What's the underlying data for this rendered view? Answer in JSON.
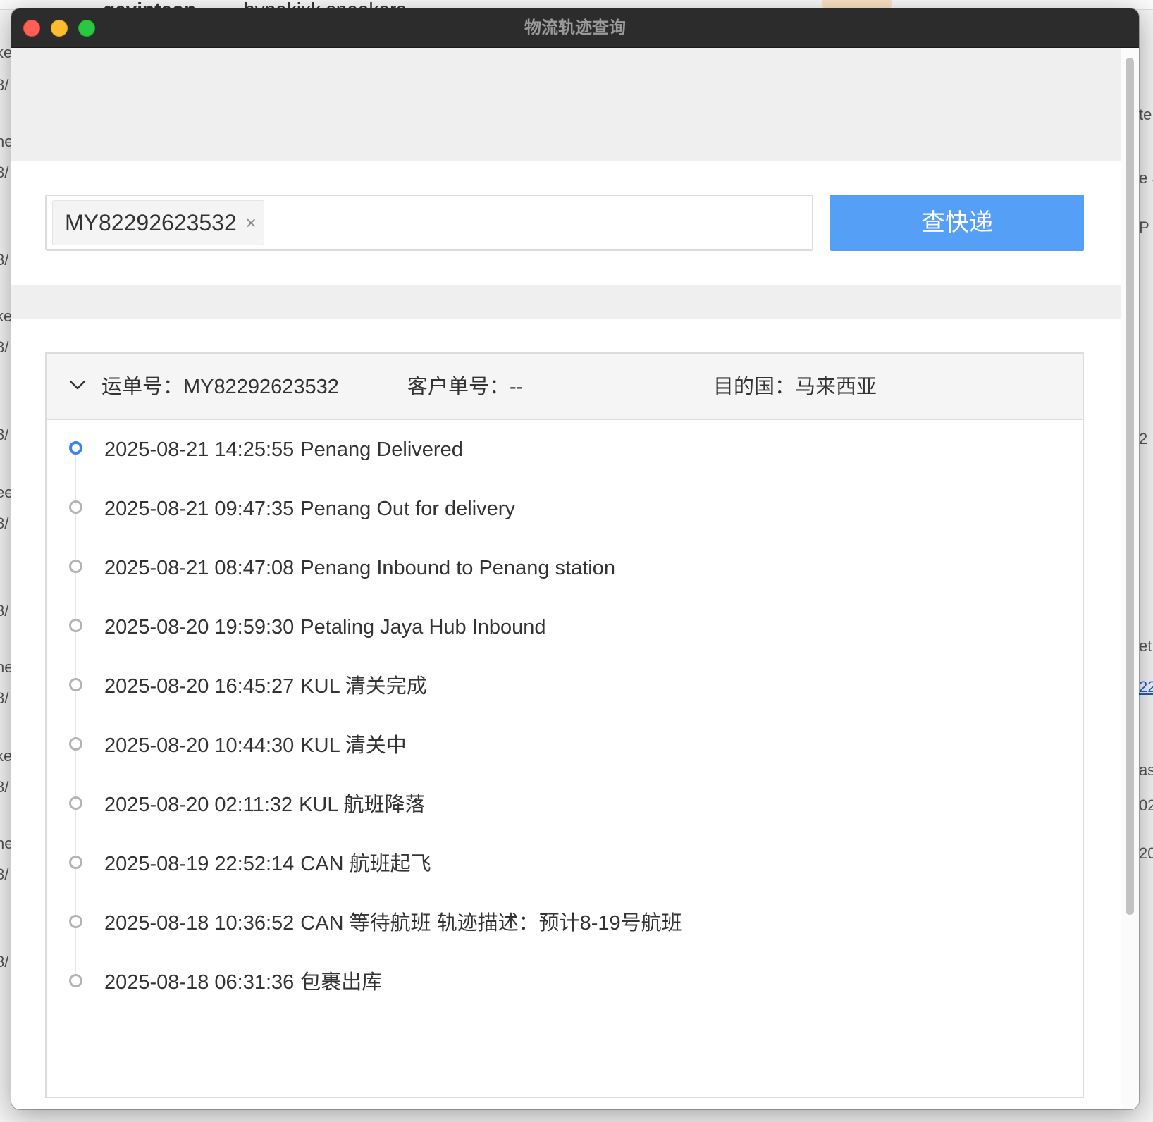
{
  "background_app": {
    "tabs": [
      {
        "label": "gevinteon"
      },
      {
        "label": "hypekixk sneakers"
      }
    ],
    "left_fragments": [
      "ke",
      "8/",
      "ne",
      "8/",
      "8/",
      "ke",
      "8/",
      "8/",
      "ee",
      "8/",
      "8/",
      "ne",
      "8/",
      "ke",
      "8/",
      "ne",
      "8/",
      "8/"
    ],
    "right_fragments": [
      "te",
      "e S",
      "P",
      "2",
      "et",
      "22",
      "as",
      "02",
      "20"
    ]
  },
  "window": {
    "title": "物流轨迹查询"
  },
  "search": {
    "tag_value": "MY82292623532",
    "tag_close_glyph": "×",
    "query_button_label": "查快递"
  },
  "result": {
    "waybill_label": "运单号：",
    "waybill_value": "MY82292623532",
    "customer_no_label": "客户单号：",
    "customer_no_value": "--",
    "destination_label": "目的国：",
    "destination_value": "马来西亚",
    "events": [
      {
        "time": "2025-08-21 14:25:55",
        "desc": "Penang Delivered",
        "active": true
      },
      {
        "time": "2025-08-21 09:47:35",
        "desc": "Penang Out for delivery",
        "active": false
      },
      {
        "time": "2025-08-21 08:47:08",
        "desc": "Penang Inbound to Penang station",
        "active": false
      },
      {
        "time": "2025-08-20 19:59:30",
        "desc": "Petaling Jaya Hub Inbound",
        "active": false
      },
      {
        "time": "2025-08-20 16:45:27",
        "desc": "KUL 清关完成",
        "active": false
      },
      {
        "time": "2025-08-20 10:44:30",
        "desc": "KUL 清关中",
        "active": false
      },
      {
        "time": "2025-08-20 02:11:32",
        "desc": "KUL 航班降落",
        "active": false
      },
      {
        "time": "2025-08-19 22:52:14",
        "desc": "CAN 航班起飞",
        "active": false
      },
      {
        "time": "2025-08-18 10:36:52",
        "desc": "CAN 等待航班 轨迹描述：预计8-19号航班",
        "active": false
      },
      {
        "time": "2025-08-18 06:31:36",
        "desc": "包裹出库",
        "active": false
      }
    ]
  },
  "colors": {
    "primary_button": "#55a0f6",
    "active_dot": "#3b84f0",
    "inactive_dot": "#b4b4b4",
    "titlebar": "#2c2c2c"
  },
  "icons": {
    "collapse": "chevron-down-icon",
    "tag_remove": "close-icon"
  }
}
